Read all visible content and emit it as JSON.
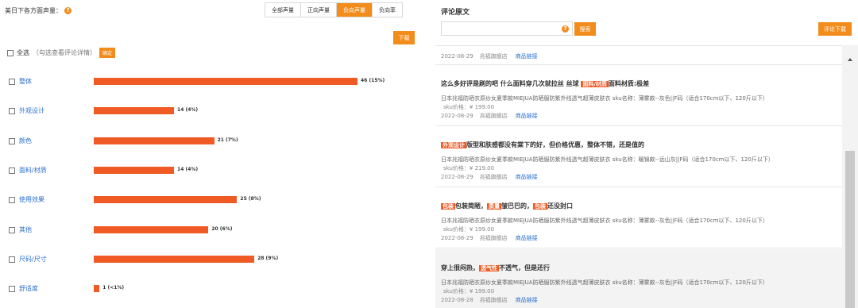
{
  "left": {
    "title": "美日下各方面声量：",
    "help_icon": "?",
    "tabs": [
      "全部声量",
      "正向声量",
      "负向声量",
      "负向率"
    ],
    "active_tab": 2,
    "download_label": "下载",
    "select_all": "全选",
    "select_hint": "（勾选查看评论详情）",
    "confirm_label": "确定",
    "bars": [
      {
        "label": "整体",
        "value": 46,
        "pct": "15%",
        "display": "46 (15%)"
      },
      {
        "label": "外观设计",
        "value": 14,
        "pct": "4%",
        "display": "14 (4%)"
      },
      {
        "label": "颜色",
        "value": 21,
        "pct": "7%",
        "display": "21 (7%)"
      },
      {
        "label": "面料/材质",
        "value": 14,
        "pct": "4%",
        "display": "14 (4%)"
      },
      {
        "label": "使用效果",
        "value": 25,
        "pct": "8%",
        "display": "25 (8%)"
      },
      {
        "label": "其他",
        "value": 20,
        "pct": "6%",
        "display": "20 (6%)"
      },
      {
        "label": "尺码/尺寸",
        "value": 28,
        "pct": "9%",
        "display": "28 (9%)"
      },
      {
        "label": "舒适度",
        "value": 1,
        "pct": "<1%",
        "display": "1 (<1%)"
      }
    ],
    "bar_color": "#f05a24"
  },
  "right": {
    "title": "评论原文",
    "search_placeholder": "",
    "search_help": "?",
    "search_label": "搜索",
    "export_label": "评论下载",
    "partial_meta": {
      "date": "2022-08-29",
      "shop": "兆福旗舰店",
      "link": "商品链接"
    },
    "items": [
      {
        "title_parts": [
          {
            "text": "这么多好评是刷的吧 什么面料穿几次就拉丝 丝球 ",
            "tag": false
          },
          {
            "text": "面料/材质",
            "tag": true
          },
          {
            "text": "面料材质:极差",
            "tag": false
          }
        ],
        "product": "日本兆福防晒衣原纱女夏季款MIEJUA防晒服防紫外线透气超薄皮肤衣    sku名称：薄雾款--灰色||F码（适合170cm以下、120斤以下）",
        "price": "sku价格：¥ 199.00",
        "date": "2022-08-29",
        "shop": "兆福旗舰店",
        "link": "商品链接"
      },
      {
        "title_parts": [
          {
            "text": "外观设计",
            "tag": true
          },
          {
            "text": "版型和肤感都没有棠下的好，但价格优惠，整体不错，还是值的",
            "tag": false
          }
        ],
        "product": "日本兆福防晒衣原纱女夏季款MIEJUA防晒服防紫外线透气超薄皮肤衣    sku名称：暖锦款--远山灰||F码（适合170cm以下、120斤以下）",
        "price": "sku价格：¥ 219.00",
        "date": "2022-08-29",
        "shop": "兆福旗舰店",
        "link": "商品链接"
      },
      {
        "title_parts": [
          {
            "text": "包装",
            "tag": true
          },
          {
            "text": "包装简陋，",
            "tag": false
          },
          {
            "text": "质量",
            "tag": true
          },
          {
            "text": "皱巴巴的，",
            "tag": false
          },
          {
            "text": "包装",
            "tag": true
          },
          {
            "text": "还没封口",
            "tag": false
          }
        ],
        "product": "日本兆福防晒衣原纱女夏季款MIEJUA防晒服防紫外线透气超薄皮肤衣    sku名称：薄雾款--灰色||F码（适合170cm以下、120斤以下）",
        "price": "sku价格：¥ 199.00",
        "date": "2022-08-29",
        "shop": "兆福旗舰店",
        "link": "商品链接"
      },
      {
        "title_parts": [
          {
            "text": "穿上很闷热，",
            "tag": false
          },
          {
            "text": "透气性",
            "tag": true
          },
          {
            "text": "不透气，但是还行",
            "tag": false
          }
        ],
        "product": "日本兆福防晒衣原纱女夏季款MIEJUA防晒服防紫外线透气超薄皮肤衣    sku名称：薄雾款--灰色||F码（适合170cm以下、120斤以下）",
        "price": "sku价格：¥ 199.00",
        "date": "2022-08-28",
        "shop": "兆福旗舰店",
        "link": "商品链接"
      }
    ]
  }
}
